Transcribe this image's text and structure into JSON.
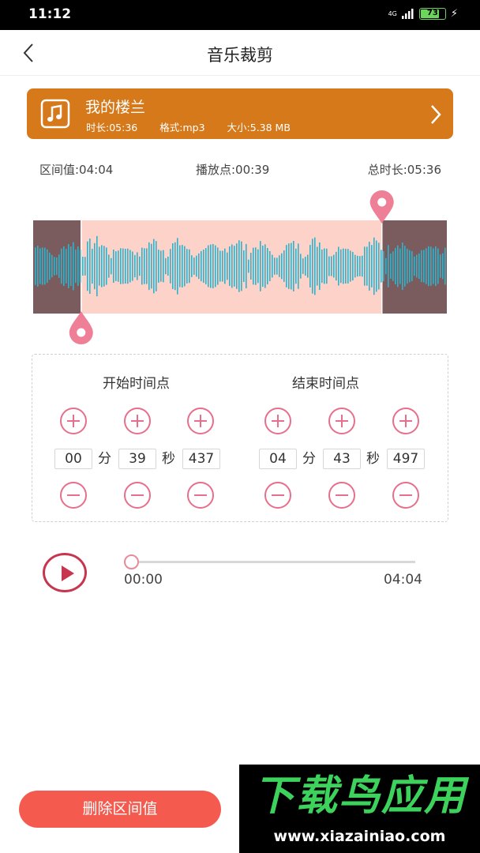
{
  "status_bar": {
    "time": "11:12",
    "network": "4G",
    "battery": "73",
    "colors": {
      "background": "#000000",
      "battery": "#6ad65a"
    }
  },
  "header": {
    "title": "音乐裁剪",
    "back_icon": "chevron-left-icon"
  },
  "file": {
    "name": "我的楼兰",
    "duration": "时长:05:36",
    "format": "格式:mp3",
    "size": "大小:5.38 MB",
    "icon": "music-note-icon",
    "color": "#d5791b"
  },
  "info": {
    "interval": "区间值:04:04",
    "play_point": "播放点:00:39",
    "total": "总时长:05:36"
  },
  "waveform": {
    "selection_start_fraction": 0.116,
    "selection_end_fraction": 0.843,
    "colors": {
      "wave": "#2fb3cc",
      "selected": "#fdd2c9",
      "unselected": "#7a5c5e",
      "marker": "#ef7f97"
    }
  },
  "start_time": {
    "title": "开始时间点",
    "minutes": "00",
    "seconds": "39",
    "millis": "437",
    "min_unit": "分",
    "sec_unit": "秒"
  },
  "end_time": {
    "title": "结束时间点",
    "minutes": "04",
    "seconds": "43",
    "millis": "497",
    "min_unit": "分",
    "sec_unit": "秒"
  },
  "player": {
    "current": "00:00",
    "end": "04:04",
    "progress": 0,
    "color": "#c7364e"
  },
  "delete_button": {
    "label": "删除区间值",
    "color": "#f45a4e"
  },
  "watermark": {
    "title": "下载鸟应用",
    "url": "www.xiazainiao.com"
  }
}
